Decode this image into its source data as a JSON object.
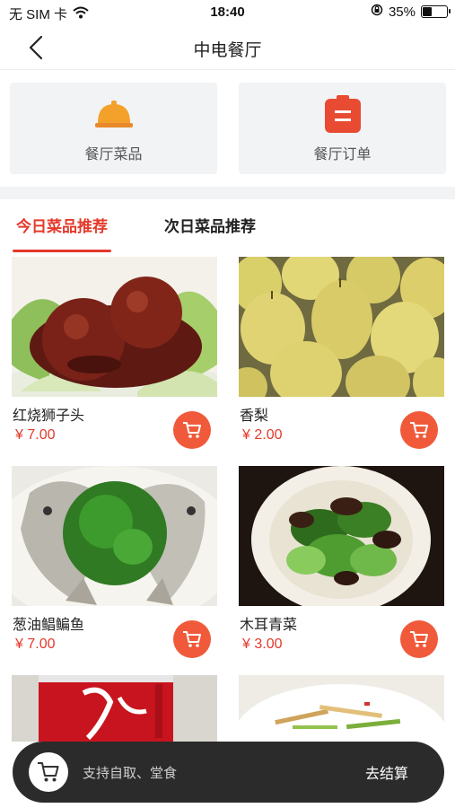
{
  "status_bar": {
    "carrier": "无 SIM 卡",
    "time": "18:40",
    "battery_percent": "35%",
    "battery_level": 0.35
  },
  "nav": {
    "title": "中电餐厅"
  },
  "quick_menu": [
    {
      "label": "餐厅菜品",
      "icon": "cloche-icon"
    },
    {
      "label": "餐厅订单",
      "icon": "clipboard-icon"
    }
  ],
  "tabs": [
    {
      "label": "今日菜品推荐",
      "active": true
    },
    {
      "label": "次日菜品推荐",
      "active": false
    }
  ],
  "dishes": [
    {
      "name": "红烧狮子头",
      "price": "¥ 7.00"
    },
    {
      "name": "香梨",
      "price": "¥ 2.00"
    },
    {
      "name": "葱油鲳鳊鱼",
      "price": "¥ 7.00"
    },
    {
      "name": "木耳青菜",
      "price": "¥ 3.00"
    },
    {
      "name": "",
      "price": ""
    },
    {
      "name": "",
      "price": ""
    }
  ],
  "bottom_bar": {
    "info": "支持自取、堂食",
    "checkout": "去结算"
  },
  "colors": {
    "accent": "#e4392b",
    "cart_button": "#f05a3a",
    "bottom_bar": "#2b2b2b",
    "menu_card": "#f1f3f5"
  }
}
